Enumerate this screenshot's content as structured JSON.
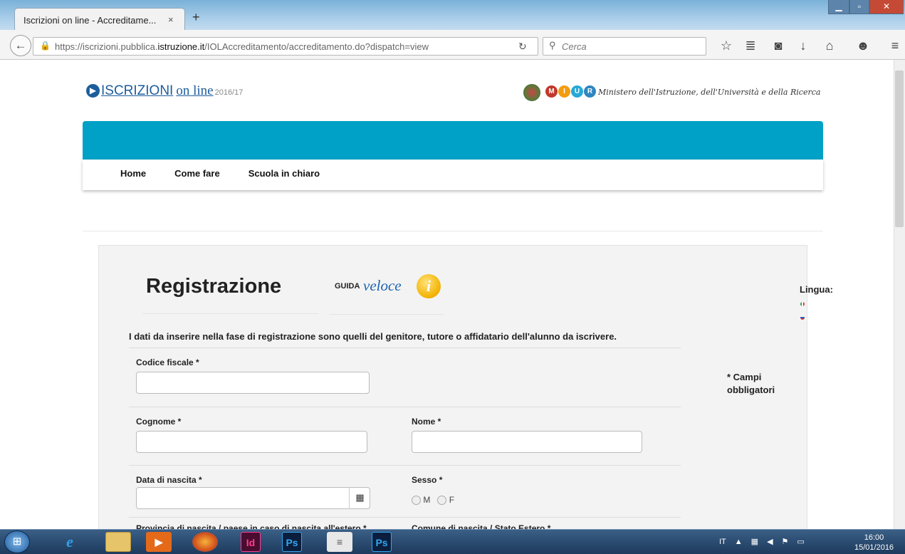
{
  "browser": {
    "tab_title": "Iscrizioni on line - Accreditame...",
    "tab_close": "×",
    "new_tab": "+",
    "url_prefix": "https://iscrizioni.pubblica.",
    "url_domain": "istruzione.it",
    "url_suffix": "/IOLAccreditamento/accreditamento.do?dispatch=view",
    "search_placeholder": "Cerca"
  },
  "header": {
    "logo_main": "ISCRIZIONI",
    "logo_online": "on line",
    "logo_year": "2016/17",
    "ministry": "Ministero dell'Istruzione, dell'Università e della Ricerca"
  },
  "menu": [
    "Home",
    "Come fare",
    "Scuola in chiaro"
  ],
  "form": {
    "title": "Registrazione",
    "guida": "GUIDA",
    "veloce": "veloce",
    "info_glyph": "i",
    "lingua": "Lingua:",
    "intro": "I dati da inserire nella fase di registrazione sono quelli del genitore, tutore o affidatario dell'alunno da iscrivere.",
    "codice_fiscale": "Codice fiscale *",
    "cognome": "Cognome *",
    "nome": "Nome *",
    "data_nascita": "Data di nascita *",
    "sesso": "Sesso *",
    "sesso_m": "M",
    "sesso_f": "F",
    "campi": "* Campi obbligatori",
    "cut_left": "Provincia di nascita / paese in caso di nascita all'estero *",
    "cut_right": "Comune di nascita / Stato Estero *"
  },
  "taskbar": {
    "apps": [
      "Id",
      "Ps",
      "Ps"
    ],
    "lang": "IT",
    "time": "16:00",
    "date": "15/01/2016"
  }
}
